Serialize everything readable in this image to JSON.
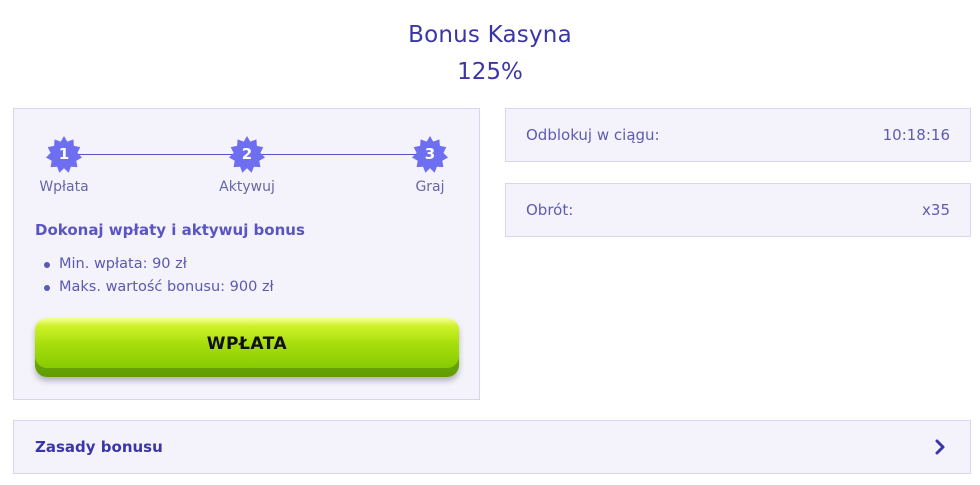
{
  "header": {
    "title": "Bonus Kasyna",
    "percent": "125%"
  },
  "steps": [
    {
      "number": "1",
      "label": "Wpłata"
    },
    {
      "number": "2",
      "label": "Aktywuj"
    },
    {
      "number": "3",
      "label": "Graj"
    }
  ],
  "offer": {
    "headline": "Dokonaj wpłaty i aktywuj bonus",
    "requirements": [
      "Min. wpłata: 90 zł",
      "Maks. wartość bonusu: 900 zł"
    ],
    "deposit_button": "WPŁATA"
  },
  "unlock": {
    "label": "Odblokuj w ciągu:",
    "value": "10:18:16"
  },
  "wagering": {
    "label": "Obrót:",
    "value": "x35"
  },
  "rules": {
    "label": "Zasady bonusu"
  },
  "colors": {
    "accent": "#3b36a8",
    "badge": "#6e6ef0",
    "button": "#9ad80a",
    "panel_bg": "#f4f3fc"
  },
  "icons": {
    "badge": "starburst-badge-icon",
    "rules": "chevron-right-icon"
  }
}
